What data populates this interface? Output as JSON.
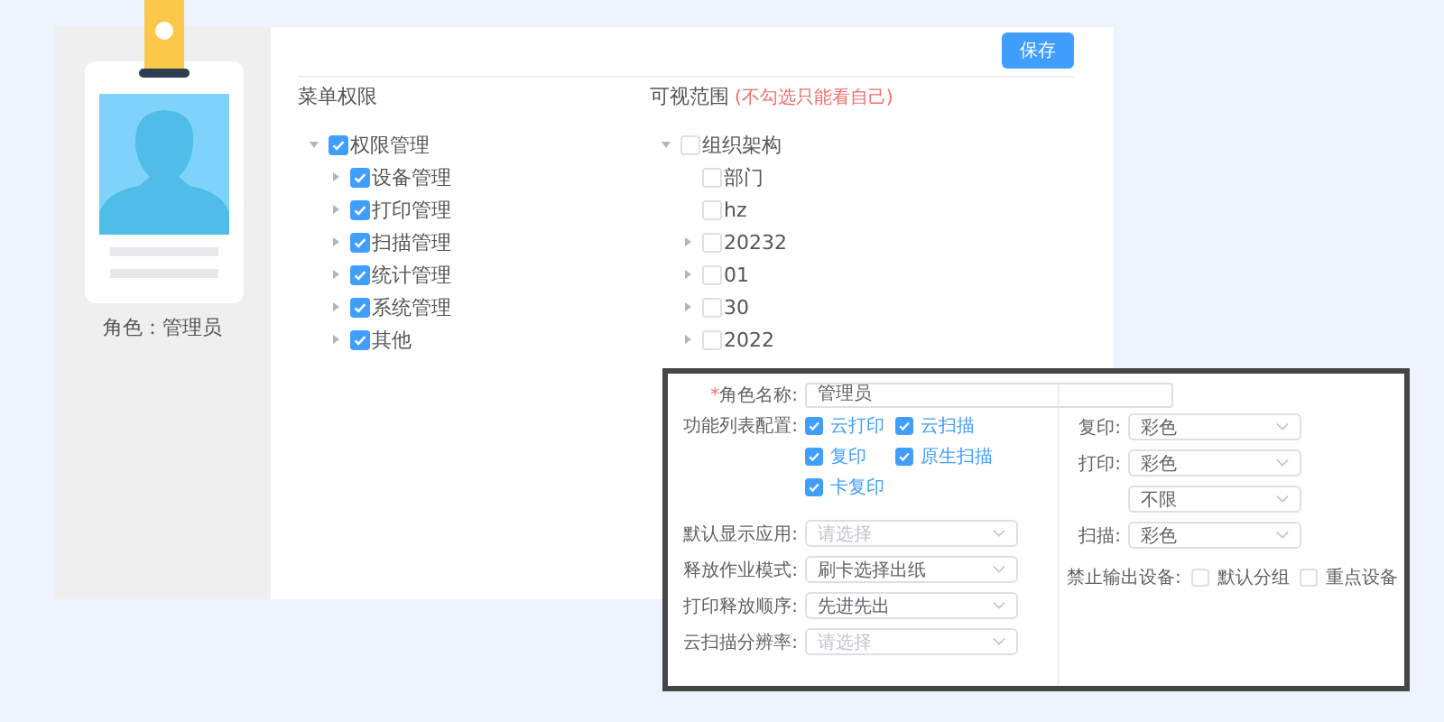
{
  "role_card": {
    "caption": "角色：管理员"
  },
  "save_button": "保存",
  "menu_permissions": {
    "title": "菜单权限",
    "tree": [
      {
        "label": "权限管理",
        "checked": true,
        "expanded": true,
        "children": [
          {
            "label": "设备管理",
            "checked": true,
            "expanded": false
          },
          {
            "label": "打印管理",
            "checked": true,
            "expanded": false
          },
          {
            "label": "扫描管理",
            "checked": true,
            "expanded": false
          },
          {
            "label": "统计管理",
            "checked": true,
            "expanded": false
          },
          {
            "label": "系统管理",
            "checked": true,
            "expanded": false
          },
          {
            "label": "其他",
            "checked": true,
            "expanded": false
          }
        ]
      }
    ]
  },
  "visible_scope": {
    "title": "可视范围",
    "hint": "(不勾选只能看自己)",
    "tree": [
      {
        "label": "组织架构",
        "checked": false,
        "expanded": true,
        "children": [
          {
            "label": "部门",
            "checked": false
          },
          {
            "label": "hz",
            "checked": false
          },
          {
            "label": "20232",
            "checked": false,
            "expanded": false
          },
          {
            "label": "01",
            "checked": false,
            "expanded": false
          },
          {
            "label": "30",
            "checked": false,
            "expanded": false
          },
          {
            "label": "2022",
            "checked": false,
            "expanded": false
          }
        ]
      }
    ]
  },
  "role_form": {
    "role_name": {
      "label": "角色名称:",
      "required_mark": "*",
      "value": "管理员"
    },
    "features": {
      "label": "功能列表配置:",
      "options": [
        {
          "label": "云打印",
          "checked": true
        },
        {
          "label": "云扫描",
          "checked": true
        },
        {
          "label": "复印",
          "checked": true
        },
        {
          "label": "原生扫描",
          "checked": true
        },
        {
          "label": "卡复印",
          "checked": true
        }
      ]
    },
    "left_selects": [
      {
        "label": "默认显示应用:",
        "placeholder": "请选择"
      },
      {
        "label": "释放作业模式:",
        "value": "刷卡选择出纸"
      },
      {
        "label": "打印释放顺序:",
        "value": "先进先出"
      },
      {
        "label": "云扫描分辨率:",
        "placeholder": "请选择"
      }
    ],
    "right_selects": [
      {
        "label": "复印:",
        "value": "彩色"
      },
      {
        "label": "打印:",
        "value": "彩色"
      },
      {
        "value": "不限"
      },
      {
        "label": "扫描:",
        "value": "彩色"
      }
    ],
    "blocked_devices": {
      "label": "禁止输出设备:",
      "options": [
        {
          "label": "默认分组",
          "checked": false
        },
        {
          "label": "重点设备",
          "checked": false
        }
      ]
    }
  }
}
